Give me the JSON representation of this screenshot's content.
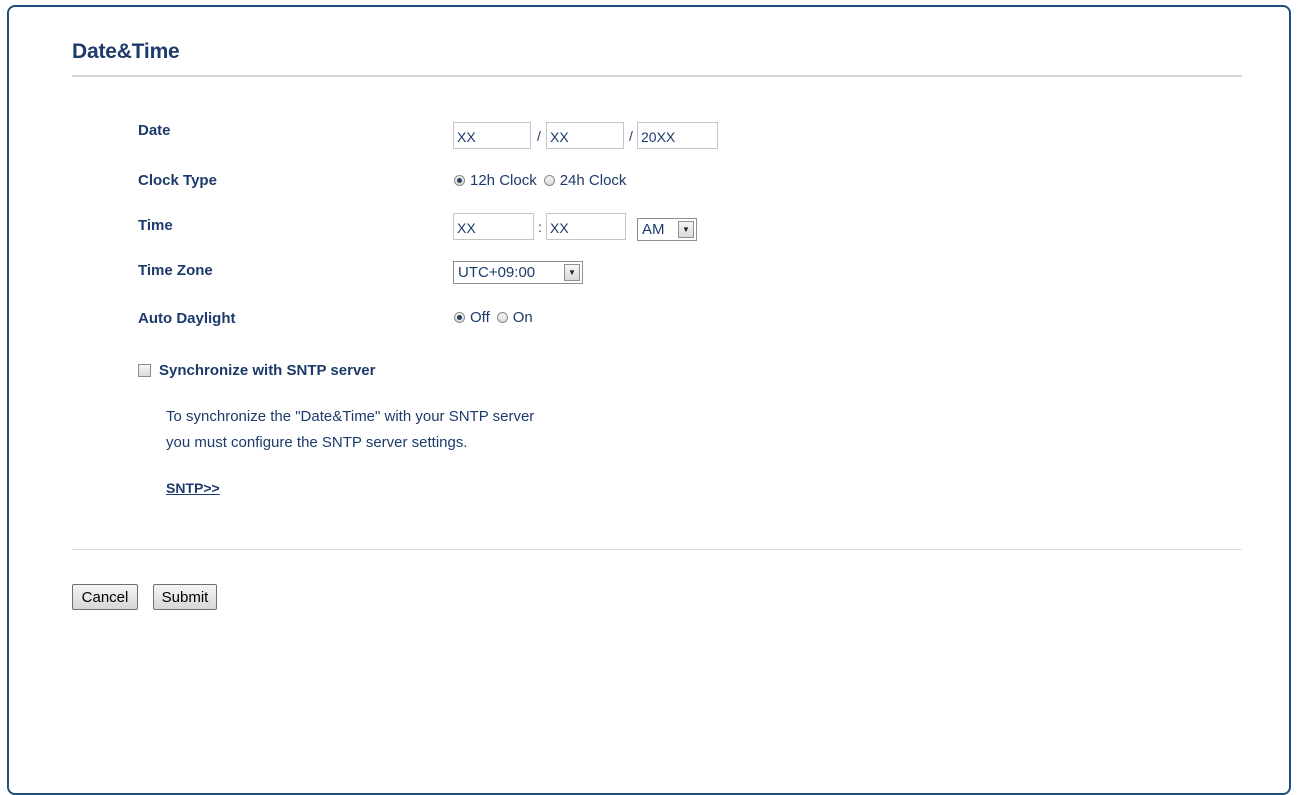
{
  "page": {
    "title": "Date&Time"
  },
  "form": {
    "date": {
      "label": "Date",
      "month": "XX",
      "day": "XX",
      "year": "20XX",
      "separator1": "/",
      "separator2": "/"
    },
    "clock_type": {
      "label": "Clock Type",
      "options": [
        "12h Clock",
        "24h Clock"
      ],
      "selected": "12h Clock"
    },
    "time": {
      "label": "Time",
      "hour": "XX",
      "minute": "XX",
      "separator": ":",
      "ampm": "AM"
    },
    "time_zone": {
      "label": "Time Zone",
      "value": "UTC+09:00"
    },
    "auto_daylight": {
      "label": "Auto Daylight",
      "options": [
        "Off",
        "On"
      ],
      "selected": "Off"
    },
    "sntp": {
      "checkbox_label": "Synchronize with SNTP server",
      "checked": false,
      "info_line1": "To synchronize the \"Date&Time\" with your SNTP server",
      "info_line2": "you must configure the SNTP server settings.",
      "link_label": "SNTP>>"
    }
  },
  "buttons": {
    "cancel": "Cancel",
    "submit": "Submit"
  },
  "icons": {
    "dropdown": "chevron-down-icon",
    "radio_checked": "radio-checked-icon",
    "radio_unchecked": "radio-unchecked-icon",
    "checkbox": "checkbox-unchecked-icon"
  },
  "colors": {
    "heading": "#1c3b6b",
    "frame_border": "#1f4e79"
  }
}
